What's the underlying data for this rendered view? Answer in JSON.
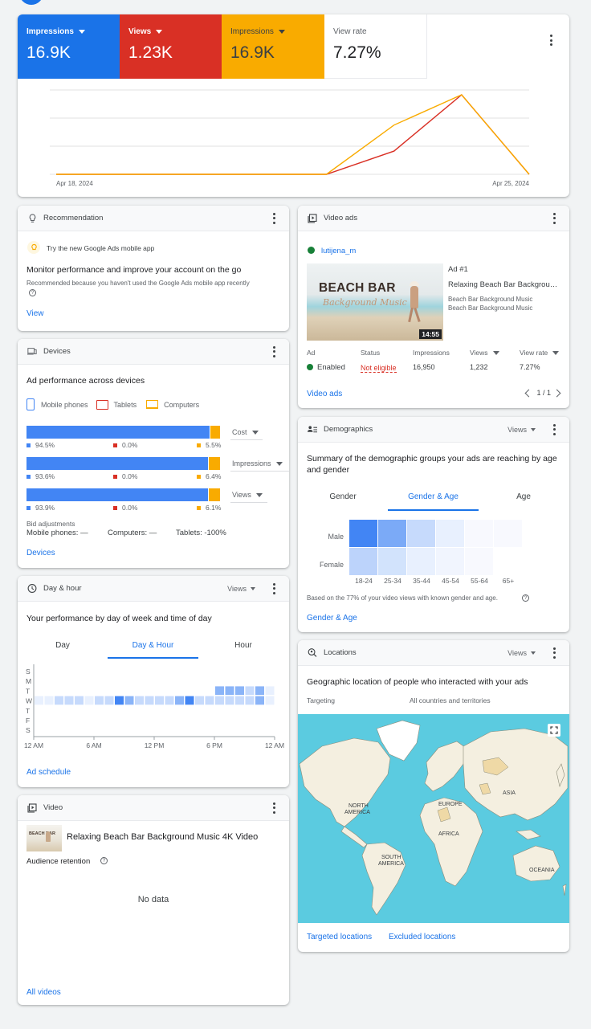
{
  "metrics": [
    {
      "label": "Impressions",
      "value": "16.9K",
      "color": "#1a73e8",
      "dropdown": true
    },
    {
      "label": "Views",
      "value": "1.23K",
      "color": "#d93025",
      "dropdown": true
    },
    {
      "label": "Impressions",
      "value": "16.9K",
      "color": "#f9ab00",
      "dropdown": true
    },
    {
      "label": "View rate",
      "value": "7.27%",
      "color": "#ffffff",
      "dropdown": false
    }
  ],
  "chart_data": {
    "type": "line",
    "x": [
      "Apr 18, 2024",
      "Apr 19, 2024",
      "Apr 20, 2024",
      "Apr 21, 2024",
      "Apr 22, 2024",
      "Apr 23, 2024",
      "Apr 24, 2024",
      "Apr 25, 2024"
    ],
    "series": [
      {
        "name": "Views",
        "color": "#d93025",
        "values": [
          0,
          0,
          0,
          0,
          0,
          360,
          1232,
          0
        ]
      },
      {
        "name": "Impressions",
        "color": "#f9ab00",
        "values": [
          0,
          0,
          0,
          0,
          0,
          10500,
          16950,
          0
        ]
      }
    ],
    "tick_labels": [
      "Apr 18, 2024",
      "Apr 25, 2024"
    ],
    "grid": true
  },
  "recommendation": {
    "header": "Recommendation",
    "tip": "Try the new Google Ads mobile app",
    "headline": "Monitor performance and improve your account on the go",
    "reason": "Recommended because you haven't used the Google Ads mobile app recently",
    "link": "View"
  },
  "devices": {
    "header": "Devices",
    "title": "Ad performance across devices",
    "legend": [
      "Mobile phones",
      "Tablets",
      "Computers"
    ],
    "colors": {
      "mobile": "#4285f4",
      "tablet": "#d93025",
      "computer": "#f9ab00"
    },
    "rows": [
      {
        "metric": "Cost",
        "mobile": 94.5,
        "tablet": 0.0,
        "computer": 5.5,
        "mobile_label": "94.5%",
        "tablet_label": "0.0%",
        "computer_label": "5.5%"
      },
      {
        "metric": "Impressions",
        "mobile": 93.6,
        "tablet": 0.0,
        "computer": 6.4,
        "mobile_label": "93.6%",
        "tablet_label": "0.0%",
        "computer_label": "6.4%"
      },
      {
        "metric": "Views",
        "mobile": 93.9,
        "tablet": 0.0,
        "computer": 6.1,
        "mobile_label": "93.9%",
        "tablet_label": "0.0%",
        "computer_label": "6.1%"
      }
    ],
    "bid_label": "Bid adjustments",
    "bid_mobile": "Mobile phones: —",
    "bid_computers": "Computers: —",
    "bid_tablets": "Tablets: -100%",
    "link": "Devices"
  },
  "dayhour": {
    "header": "Day & hour",
    "dropdown": "Views",
    "title": "Your performance by day of week and time of day",
    "tabs": [
      "Day",
      "Day & Hour",
      "Hour"
    ],
    "days": [
      "S",
      "M",
      "T",
      "W",
      "T",
      "F",
      "S"
    ],
    "xticks": [
      "12 AM",
      "6 AM",
      "12 PM",
      "6 PM",
      "12 AM"
    ],
    "link": "Ad schedule"
  },
  "video": {
    "header": "Video",
    "title": "Relaxing Beach Bar Background Music 4K Video",
    "retention": "Audience retention",
    "nodata": "No data",
    "link": "All videos",
    "thumb_title": "BEACH BAR"
  },
  "videoads": {
    "header": "Video ads",
    "channel": "lutijena_m",
    "thumb_title": "BEACH BAR",
    "thumb_sub": "Background Music",
    "duration": "14:55",
    "ad_num": "Ad #1",
    "ad_title": "Relaxing Beach Bar Backgrou…",
    "line1": "Beach Bar Background Music",
    "line2": "Beach Bar Background Music",
    "cols": [
      "Ad",
      "Status",
      "Impressions",
      "Views",
      "View rate"
    ],
    "vals": [
      "Enabled",
      "Not eligible",
      "16,950",
      "1,232",
      "7.27%"
    ],
    "link": "Video ads",
    "pager": "1 / 1"
  },
  "demographics": {
    "header": "Demographics",
    "dropdown": "Views",
    "title": "Summary of the demographic groups your ads are reaching by age and gender",
    "tabs": [
      "Gender",
      "Gender & Age",
      "Age"
    ],
    "rows": [
      "Male",
      "Female"
    ],
    "ages": [
      "18-24",
      "25-34",
      "35-44",
      "45-54",
      "55-64",
      "65+"
    ],
    "note": "Based on the 77% of your video views with known gender and age.",
    "link": "Gender & Age"
  },
  "locations": {
    "header": "Locations",
    "dropdown": "Views",
    "title": "Geographic location of people who interacted with your ads",
    "targeting_label": "Targeting",
    "targeting_value": "All countries and territories",
    "map_labels": [
      "ASIA",
      "EUROPE",
      "NORTH AMERICA",
      "AFRICA",
      "SOUTH AMERICA",
      "OCEANIA"
    ],
    "link1": "Targeted locations",
    "link2": "Excluded locations"
  }
}
